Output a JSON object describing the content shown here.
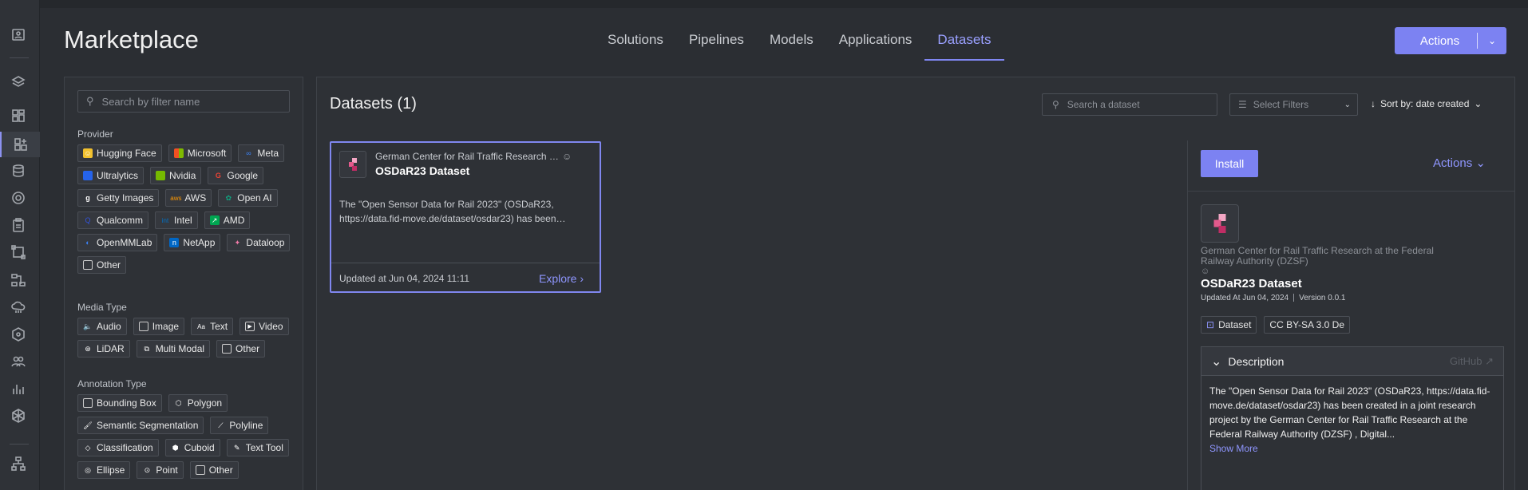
{
  "header": {
    "title": "Marketplace",
    "tabs": [
      {
        "label": "Solutions"
      },
      {
        "label": "Pipelines"
      },
      {
        "label": "Models"
      },
      {
        "label": "Applications"
      },
      {
        "label": "Datasets"
      }
    ],
    "active_tab": "Datasets",
    "actions_label": "Actions"
  },
  "filters": {
    "search_placeholder": "Search by filter name",
    "provider": {
      "title": "Provider",
      "items": [
        "Hugging Face",
        "Microsoft",
        "Meta",
        "Ultralytics",
        "Nvidia",
        "Google",
        "Getty Images",
        "AWS",
        "Open AI",
        "Qualcomm",
        "Intel",
        "AMD",
        "OpenMMLab",
        "NetApp",
        "Dataloop",
        "Other"
      ]
    },
    "media": {
      "title": "Media Type",
      "items": [
        "Audio",
        "Image",
        "Text",
        "Video",
        "LiDAR",
        "Multi Modal",
        "Other"
      ]
    },
    "annotation": {
      "title": "Annotation Type",
      "items": [
        "Bounding Box",
        "Polygon",
        "Semantic Segmentation",
        "Polyline",
        "Classification",
        "Cuboid",
        "Text Tool",
        "Ellipse",
        "Point",
        "Other"
      ]
    }
  },
  "main": {
    "title": "Datasets (1)",
    "search_placeholder": "Search a dataset",
    "filter_placeholder": "Select Filters",
    "sort_label": "Sort by: date created"
  },
  "card": {
    "org": "German Center for Rail Traffic Research at the Federal Railway Authority (DZSF)",
    "name": "OSDaR23 Dataset",
    "description": "The \"Open Sensor Data for Rail 2023\" (OSDaR23, https://data.fid-move.de/dataset/osdar23) has been…",
    "updated": "Updated at Jun 04, 2024 11:11",
    "explore": "Explore"
  },
  "detail": {
    "install": "Install",
    "actions": "Actions",
    "org": "German Center for Rail Traffic Research at the Federal Railway Authority (DZSF)",
    "name": "OSDaR23 Dataset",
    "updated": "Updated At Jun 04, 2024",
    "version": "Version 0.0.1",
    "tag_type": "Dataset",
    "tag_license": "CC BY-SA 3.0 De",
    "desc_title": "Description",
    "github": "GitHub",
    "desc_text": "The \"Open Sensor Data for Rail 2023\" (OSDaR23, https://data.fid-move.de/dataset/osdar23) has been created in a joint research project by the German Center for Rail Traffic Research at the Federal Railway Authority (DZSF) , Digital...",
    "show_more": "Show More"
  },
  "colors": {
    "accent": "#7c82f2",
    "link": "#8f96ff",
    "background": "#2b2e33"
  }
}
